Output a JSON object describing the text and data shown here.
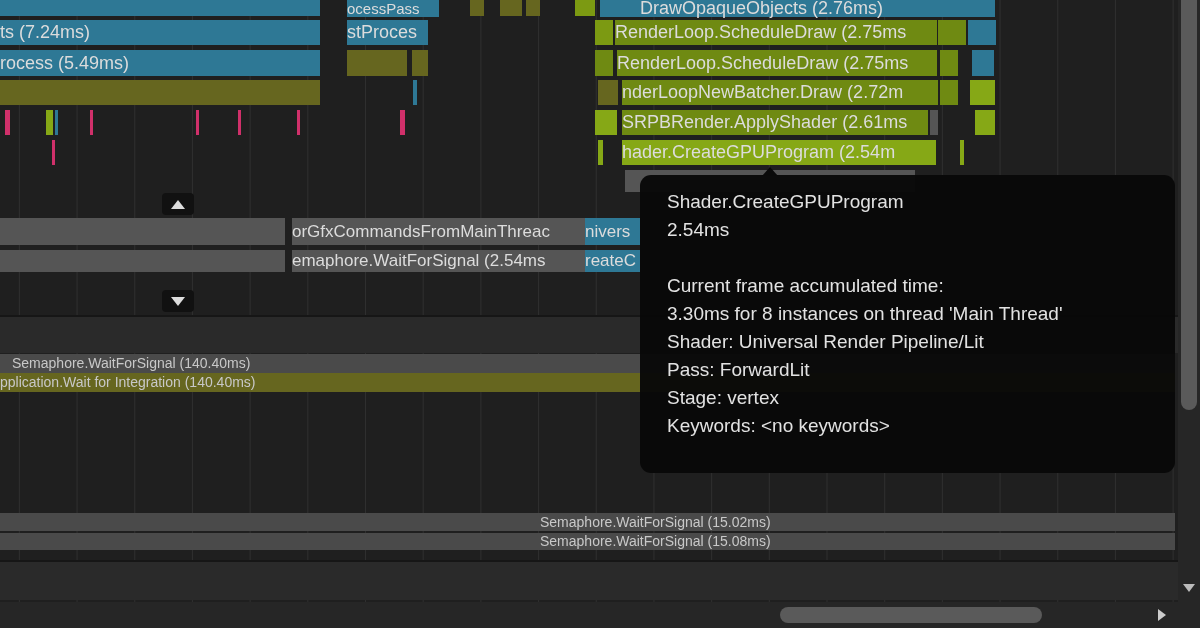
{
  "main_thread": {
    "bars": [
      {
        "label": "ts (7.24ms)",
        "color": "#2e7895"
      },
      {
        "label": "rocess (5.49ms)",
        "color": "#2e7895"
      },
      {
        "label": "ocessPass",
        "color": "#2e7895"
      },
      {
        "label": "stProces",
        "color": "#2e7895"
      },
      {
        "label": "DrawOpaqueObjects (2.76ms)",
        "color": "#2e7895"
      },
      {
        "label": "RenderLoop.ScheduleDraw (2.75ms",
        "color": "#6f8a12"
      },
      {
        "label": "RenderLoop.ScheduleDraw (2.75ms",
        "color": "#6f8a12"
      },
      {
        "label": "nderLoopNewBatcher.Draw (2.72m",
        "color": "#6f8a12"
      },
      {
        "label": "SRPBRender.ApplyShader (2.61ms",
        "color": "#6f8a12"
      },
      {
        "label": "hader.CreateGPUProgram (2.54m",
        "color": "#86a816"
      }
    ]
  },
  "render_thread": {
    "bars": [
      {
        "label": "orGfxCommandsFromMainThreac",
        "color": "#555555"
      },
      {
        "label": "emaphore.WaitForSignal (2.54ms",
        "color": "#555555"
      },
      {
        "label": "nivers",
        "color": "#2e7895"
      },
      {
        "label": "reateC",
        "color": "#2e7895"
      }
    ]
  },
  "other_threads": {
    "bars": [
      {
        "label": "Semaphore.WaitForSignal (140.40ms)",
        "color": "#4a4a4a"
      },
      {
        "label": "pplication.Wait for Integration (140.40ms)",
        "color": "#66661f"
      },
      {
        "label": "Semaphore.WaitForSignal (15.02ms)",
        "color": "#4a4a4a"
      },
      {
        "label": "Semaphore.WaitForSignal (15.08ms)",
        "color": "#4a4a4a"
      }
    ]
  },
  "tooltip": {
    "title": "Shader.CreateGPUProgram",
    "duration": "2.54ms",
    "lines": [
      "Current frame accumulated time:",
      "3.30ms for 8 instances on thread 'Main Thread'",
      "Shader: Universal Render Pipeline/Lit",
      "Pass: ForwardLit",
      "Stage: vertex",
      "Keywords: <no keywords>"
    ]
  }
}
